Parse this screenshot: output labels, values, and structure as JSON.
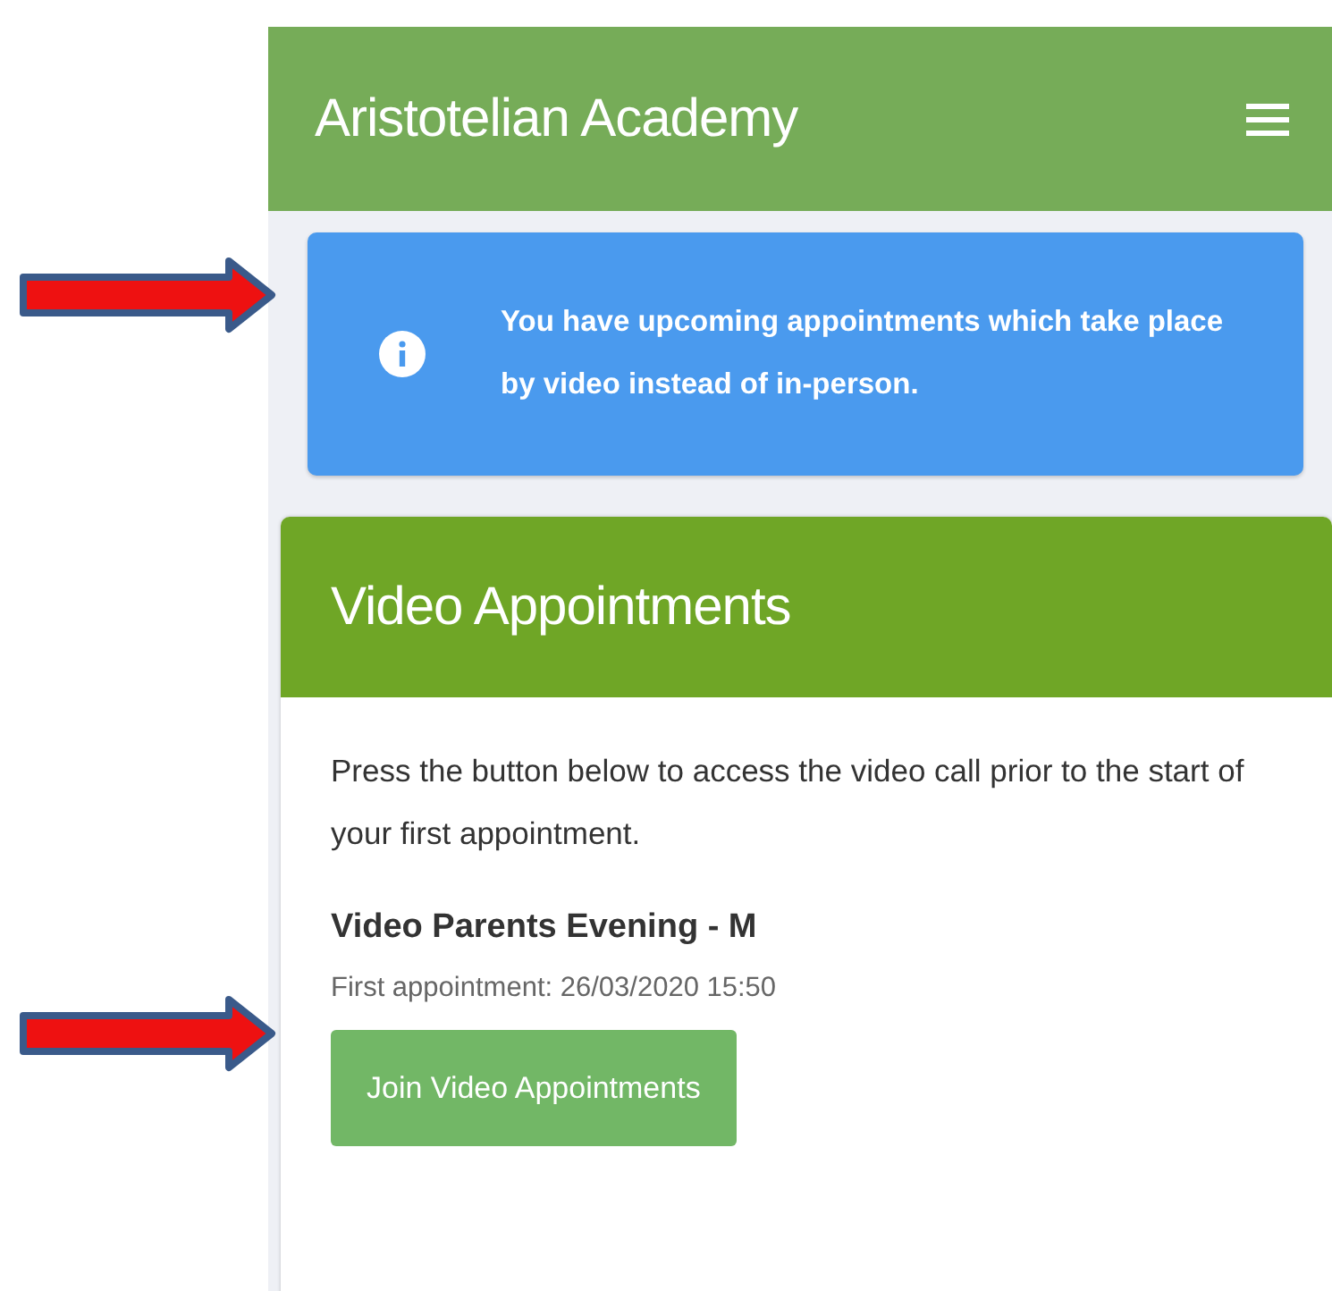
{
  "header": {
    "title": "Aristotelian Academy"
  },
  "alert": {
    "message": "You have upcoming appointments which take place by video instead of in-person."
  },
  "card": {
    "title": "Video Appointments",
    "intro": "Press the button below to access the video call prior to the start of your first appointment.",
    "event": "Video Parents Evening - M",
    "first_appointment": "First appointment: 26/03/2020 15:50",
    "button": "Join Video Appointments"
  }
}
